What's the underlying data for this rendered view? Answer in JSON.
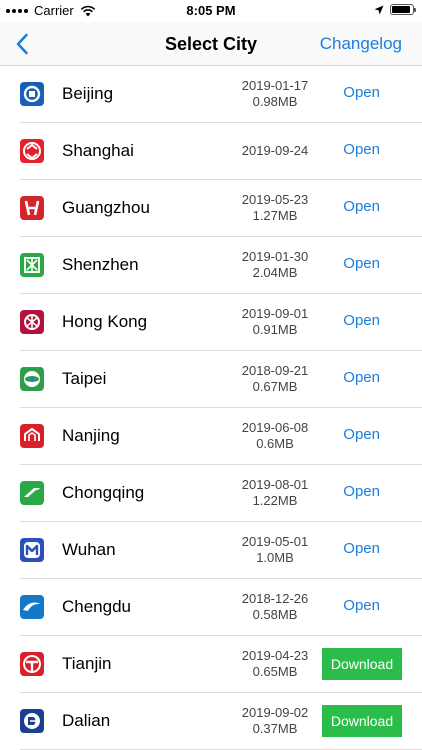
{
  "status_bar": {
    "carrier": "Carrier",
    "time": "8:05 PM",
    "battery_level": 0.9
  },
  "nav": {
    "title": "Select City",
    "changelog_label": "Changelog"
  },
  "colors": {
    "accent": "#1a7fe0",
    "download_bg": "#2bbd4a"
  },
  "cities": [
    {
      "name": "Beijing",
      "date": "2019-01-17",
      "size": "0.98MB",
      "action": "Open",
      "logo_color": "#1660b8",
      "icon": "beijing-subway-logo-icon"
    },
    {
      "name": "Shanghai",
      "date": "2019-09-24",
      "size": "",
      "action": "Open",
      "logo_color": "#e3202b",
      "icon": "shanghai-metro-logo-icon"
    },
    {
      "name": "Guangzhou",
      "date": "2019-05-23",
      "size": "1.27MB",
      "action": "Open",
      "logo_color": "#d3242b",
      "icon": "guangzhou-metro-logo-icon"
    },
    {
      "name": "Shenzhen",
      "date": "2019-01-30",
      "size": "2.04MB",
      "action": "Open",
      "logo_color": "#2aa845",
      "icon": "shenzhen-metro-logo-icon"
    },
    {
      "name": "Hong Kong",
      "date": "2019-09-01",
      "size": "0.91MB",
      "action": "Open",
      "logo_color": "#b3123c",
      "icon": "hong-kong-mtr-logo-icon"
    },
    {
      "name": "Taipei",
      "date": "2018-09-21",
      "size": "0.67MB",
      "action": "Open",
      "logo_color": "#2e9d4c",
      "icon": "taipei-metro-logo-icon"
    },
    {
      "name": "Nanjing",
      "date": "2019-06-08",
      "size": "0.6MB",
      "action": "Open",
      "logo_color": "#d9202a",
      "icon": "nanjing-metro-logo-icon"
    },
    {
      "name": "Chongqing",
      "date": "2019-08-01",
      "size": "1.22MB",
      "action": "Open",
      "logo_color": "#2aa845",
      "icon": "chongqing-rail-logo-icon"
    },
    {
      "name": "Wuhan",
      "date": "2019-05-01",
      "size": "1.0MB",
      "action": "Open",
      "logo_color": "#2b50b8",
      "icon": "wuhan-metro-logo-icon"
    },
    {
      "name": "Chengdu",
      "date": "2018-12-26",
      "size": "0.58MB",
      "action": "Open",
      "logo_color": "#1478c8",
      "icon": "chengdu-metro-logo-icon"
    },
    {
      "name": "Tianjin",
      "date": "2019-04-23",
      "size": "0.65MB",
      "action": "Download",
      "logo_color": "#d9202a",
      "icon": "tianjin-metro-logo-icon"
    },
    {
      "name": "Dalian",
      "date": "2019-09-02",
      "size": "0.37MB",
      "action": "Download",
      "logo_color": "#1c3f94",
      "icon": "dalian-metro-logo-icon"
    }
  ]
}
